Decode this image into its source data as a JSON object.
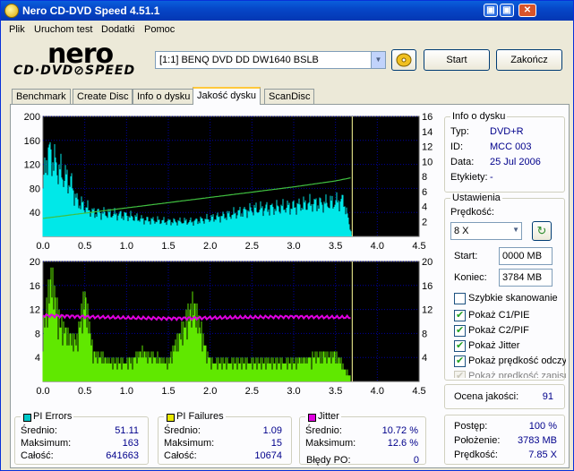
{
  "window": {
    "title": "Nero CD-DVD Speed 4.51.1",
    "min_glyph": "▣",
    "restore_glyph": "▣",
    "close_glyph": "✕"
  },
  "menu": [
    "Plik",
    "Uruchom test",
    "Dodatki",
    "Pomoc"
  ],
  "logo": {
    "line1": "nero",
    "line2": "CD·DVD⊘SPEED"
  },
  "drive": {
    "selected": "[1:1]  BENQ DVD DD DW1640 BSLB"
  },
  "toolbar": {
    "start_label": "Start",
    "exit_label": "Zakończ"
  },
  "tabs": [
    "Benchmark",
    "Create Disc",
    "Info o dysku",
    "Jakość dysku",
    "ScanDisc"
  ],
  "active_tab": 3,
  "disc_info": {
    "title": "Info o dysku",
    "rows": [
      {
        "label": "Typ:",
        "value": "DVD+R"
      },
      {
        "label": "ID:",
        "value": "MCC 003"
      },
      {
        "label": "Data:",
        "value": "25 Jul 2006"
      },
      {
        "label": "Etykiety:",
        "value": "-"
      }
    ]
  },
  "settings": {
    "title": "Ustawienia",
    "speed_label": "Prędkość:",
    "speed_value": "8 X",
    "start_label": "Start:",
    "start_value": "0000 MB",
    "end_label": "Koniec:",
    "end_value": "3784 MB",
    "checkboxes": [
      {
        "label": "Szybkie skanowanie",
        "checked": false,
        "disabled": false
      },
      {
        "label": "Pokaż C1/PIE",
        "checked": true,
        "disabled": false
      },
      {
        "label": "Pokaż C2/PIF",
        "checked": true,
        "disabled": false
      },
      {
        "label": "Pokaż Jitter",
        "checked": true,
        "disabled": false
      },
      {
        "label": "Pokaż prędkość odczytu",
        "checked": true,
        "disabled": false
      },
      {
        "label": "Pokaż prędkość zapisu",
        "checked": true,
        "disabled": true
      }
    ]
  },
  "quality": {
    "label": "Ocena jakości:",
    "value": "91"
  },
  "pi_errors": {
    "title": "PI Errors",
    "color": "#00c8c8",
    "avg_label": "Średnio:",
    "avg": "51.11",
    "max_label": "Maksimum:",
    "max": "163",
    "total_label": "Całość:",
    "total": "641663"
  },
  "pi_failures": {
    "title": "PI Failures",
    "color": "#e8e800",
    "avg_label": "Średnio:",
    "avg": "1.09",
    "max_label": "Maksimum:",
    "max": "15",
    "total_label": "Całość:",
    "total": "10674"
  },
  "jitter": {
    "title": "Jitter",
    "color": "#e000e0",
    "avg_label": "Średnio:",
    "avg": "10.72 %",
    "max_label": "Maksimum:",
    "max": "12.6 %",
    "po_label": "Błędy PO:",
    "po": "0"
  },
  "progress": {
    "progress_label": "Postęp:",
    "progress": "100 %",
    "position_label": "Położenie:",
    "position": "3783 MB",
    "speed_label": "Prędkość:",
    "speed": "7.85 X"
  },
  "chart_data": [
    {
      "type": "area",
      "name": "PI Errors chart",
      "x_ticks": [
        "0.0",
        "0.5",
        "1.0",
        "1.5",
        "2.0",
        "2.5",
        "3.0",
        "3.5",
        "4.0",
        "4.5"
      ],
      "xlim": [
        0,
        4.5
      ],
      "y_left_ticks": [
        "200",
        "160",
        "120",
        "80",
        "40"
      ],
      "ylim_left": [
        0,
        200
      ],
      "y_right_ticks": [
        "16",
        "14",
        "12",
        "10",
        "8",
        "6",
        "4",
        "2"
      ],
      "ylim_right": [
        0,
        16
      ],
      "end_marker_x": 3.7,
      "series": [
        {
          "role": "pi_errors",
          "color": "#00e8e8",
          "x": [
            0.0,
            0.05,
            0.1,
            0.15,
            0.2,
            0.25,
            0.3,
            0.35,
            0.4,
            0.5,
            0.6,
            0.8,
            1.0,
            1.2,
            1.5,
            1.8,
            2.0,
            2.2,
            2.5,
            2.8,
            3.0,
            3.2,
            3.4,
            3.6,
            3.7
          ],
          "values": [
            80,
            140,
            135,
            120,
            110,
            100,
            95,
            85,
            60,
            50,
            40,
            38,
            35,
            28,
            25,
            25,
            30,
            35,
            45,
            48,
            50,
            55,
            55,
            60,
            0
          ]
        },
        {
          "role": "read_speed",
          "axis": "right",
          "color": "#40c040",
          "x": [
            0.0,
            0.5,
            1.0,
            1.5,
            2.0,
            2.5,
            3.0,
            3.5,
            3.7
          ],
          "values": [
            2.4,
            3.1,
            3.8,
            4.5,
            5.2,
            5.9,
            6.6,
            7.4,
            7.85
          ]
        }
      ]
    },
    {
      "type": "bar",
      "name": "PI Failures chart",
      "x_ticks": [
        "0.0",
        "0.5",
        "1.0",
        "1.5",
        "2.0",
        "2.5",
        "3.0",
        "3.5",
        "4.0",
        "4.5"
      ],
      "xlim": [
        0,
        4.5
      ],
      "y_left_ticks": [
        "20",
        "16",
        "12",
        "8",
        "4"
      ],
      "ylim_left": [
        0,
        20
      ],
      "y_right_ticks": [
        "20",
        "16",
        "12",
        "8",
        "4"
      ],
      "ylim_right": [
        0,
        20
      ],
      "end_marker_x": 3.7,
      "series": [
        {
          "role": "pi_failures",
          "color": "#60e800",
          "x": [
            0.0,
            0.1,
            0.2,
            0.3,
            0.4,
            0.5,
            0.6,
            0.8,
            1.0,
            1.2,
            1.5,
            1.8,
            2.0,
            2.5,
            3.0,
            3.5,
            3.7
          ],
          "values": [
            5,
            11,
            6,
            5,
            4,
            9,
            3,
            2,
            2,
            3,
            2,
            8,
            2,
            2,
            2,
            3,
            0
          ]
        },
        {
          "role": "jitter",
          "axis": "right",
          "color": "#e000e0",
          "x": [
            0.0,
            0.5,
            1.0,
            1.5,
            2.0,
            2.5,
            3.0,
            3.5,
            3.7
          ],
          "values": [
            11.0,
            10.8,
            10.6,
            10.5,
            10.6,
            10.7,
            10.8,
            10.7,
            10.7
          ]
        }
      ]
    }
  ]
}
